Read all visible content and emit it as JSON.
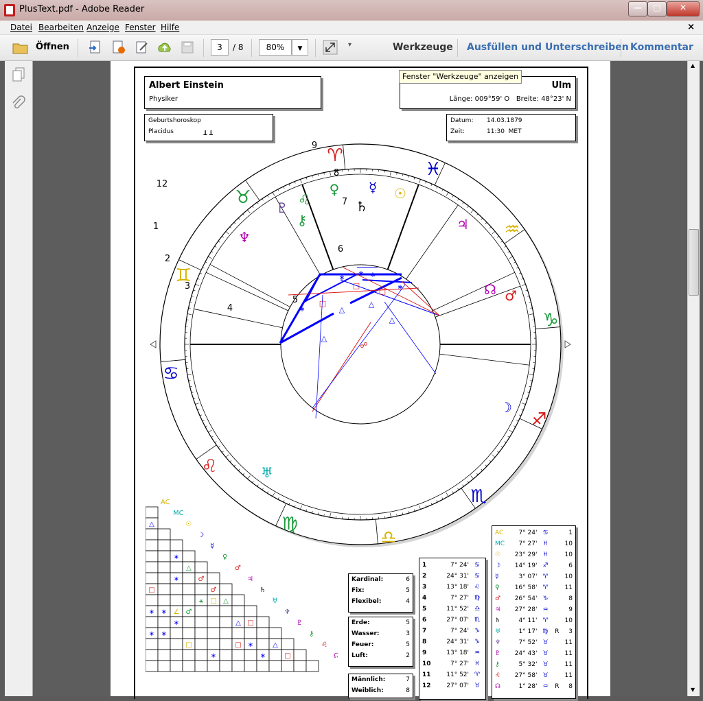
{
  "window": {
    "title": "PlusText.pdf - Adobe Reader"
  },
  "menu": {
    "items": [
      "Datei",
      "Bearbeiten",
      "Anzeige",
      "Fenster",
      "Hilfe"
    ],
    "close": "×"
  },
  "toolbar": {
    "open_label": "Öffnen",
    "page_current": "3",
    "page_total": "/ 8",
    "zoom": "80%",
    "tools": "Werkzeuge",
    "fill_sign": "Ausfüllen und Unterschreiben",
    "comment": "Kommentar",
    "tooltip": "Fenster \"Werkzeuge\" anzeigen"
  },
  "chart": {
    "name": "Albert Einstein",
    "profession": "Physiker",
    "city": "Ulm",
    "coords": "Länge: 009°59' O   Breite: 48°23' N",
    "type": "Geburtshoroskop",
    "system": "Placidus",
    "date_label": "Datum:",
    "date": "14.03.1879",
    "time_label": "Zeit:",
    "time": "11:30  MET",
    "houses": [
      "1",
      "2",
      "3",
      "4",
      "5",
      "6",
      "7",
      "8",
      "9",
      "10",
      "11",
      "12"
    ]
  },
  "elements": {
    "modes": [
      [
        "Kardinal:",
        "6"
      ],
      [
        "Fix:",
        "5"
      ],
      [
        "Flexibel:",
        "4"
      ]
    ],
    "elements": [
      [
        "Erde:",
        "5"
      ],
      [
        "Wasser:",
        "3"
      ],
      [
        "Feuer:",
        "5"
      ],
      [
        "Luft:",
        "2"
      ]
    ],
    "gender": [
      [
        "Männlich:",
        "7"
      ],
      [
        "Weiblich:",
        "8"
      ]
    ]
  },
  "house_cusps": [
    [
      "1",
      "7° 24'",
      "♋"
    ],
    [
      "2",
      "24° 31'",
      "♋"
    ],
    [
      "3",
      "13° 18'",
      "♌"
    ],
    [
      "4",
      "7° 27'",
      "♍"
    ],
    [
      "5",
      "11° 52'",
      "♎"
    ],
    [
      "6",
      "27° 07'",
      "♏"
    ],
    [
      "7",
      "7° 24'",
      "♑"
    ],
    [
      "8",
      "24° 31'",
      "♑"
    ],
    [
      "9",
      "13° 18'",
      "♒"
    ],
    [
      "10",
      "7° 27'",
      "♓"
    ],
    [
      "11",
      "11° 52'",
      "♈"
    ],
    [
      "12",
      "27° 07'",
      "♉"
    ]
  ],
  "planets": [
    [
      "AC",
      "7° 24'",
      "♋",
      "",
      "1"
    ],
    [
      "MC",
      "7° 27'",
      "♓",
      "",
      "10"
    ],
    [
      "☉",
      "23° 29'",
      "♓",
      "",
      "10"
    ],
    [
      "☽",
      "14° 19'",
      "♐",
      "",
      "6"
    ],
    [
      "☿",
      "3° 07'",
      "♈",
      "",
      "10"
    ],
    [
      "♀",
      "16° 58'",
      "♈",
      "",
      "11"
    ],
    [
      "♂",
      "26° 54'",
      "♑",
      "",
      "8"
    ],
    [
      "♃",
      "27° 28'",
      "♒",
      "",
      "9"
    ],
    [
      "♄",
      "4° 11'",
      "♈",
      "",
      "10"
    ],
    [
      "♅",
      "1° 17'",
      "♍",
      "R",
      "3"
    ],
    [
      "♆",
      "7° 52'",
      "♉",
      "",
      "11"
    ],
    [
      "♇",
      "24° 43'",
      "♉",
      "",
      "11"
    ],
    [
      "⚷",
      "5° 32'",
      "♉",
      "",
      "11"
    ],
    [
      "♌",
      "27° 58'",
      "♉",
      "",
      "11"
    ],
    [
      "☊",
      "1° 28'",
      "♒",
      "R",
      "8"
    ]
  ],
  "colors": {
    "red": "#d81b1b",
    "blue": "#0000ff",
    "green": "#1a9a3a",
    "yellow": "#d9b300",
    "purple": "#b000b0"
  }
}
